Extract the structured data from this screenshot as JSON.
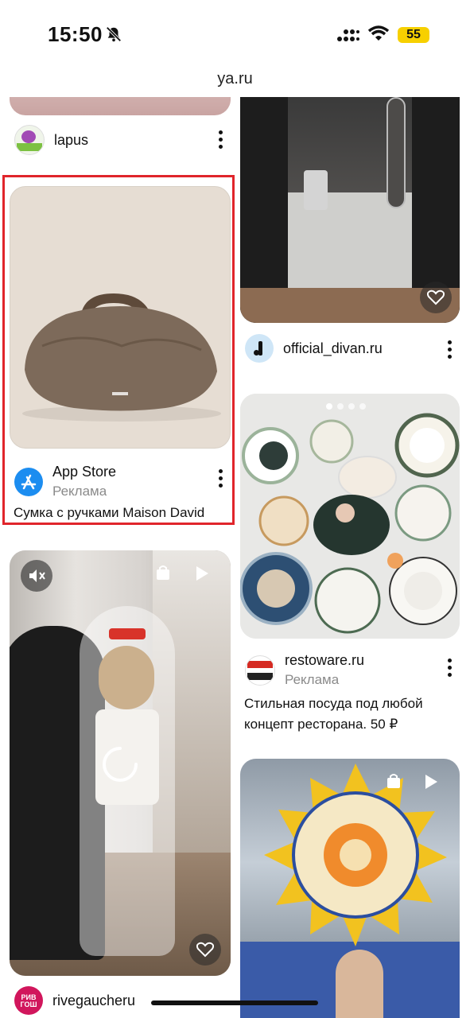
{
  "status": {
    "time": "15:50",
    "battery": "55"
  },
  "browser": {
    "url": "ya.ru"
  },
  "feed": {
    "left": [
      {
        "user": "lapus"
      },
      {
        "user": "App Store",
        "sub": "Реклама",
        "desc": "Сумка с ручками Maison David"
      },
      {
        "user": "rivegaucheru"
      }
    ],
    "right": [
      {
        "user": "official_divan.ru"
      },
      {
        "user": "restoware.ru",
        "sub": "Реклама",
        "desc_line1": "Стильная посуда под любой",
        "desc_line2": "концепт ресторана. 50 ₽"
      }
    ]
  },
  "colors": {
    "highlight": "#e0252b",
    "battery": "#f7d000",
    "appstore": "#1c8df0"
  },
  "icons": [
    "bell-off-icon",
    "signal-icon",
    "wifi-icon",
    "heart-icon",
    "more-icon",
    "mute-icon",
    "play-icon",
    "bag-icon",
    "loading-icon"
  ]
}
